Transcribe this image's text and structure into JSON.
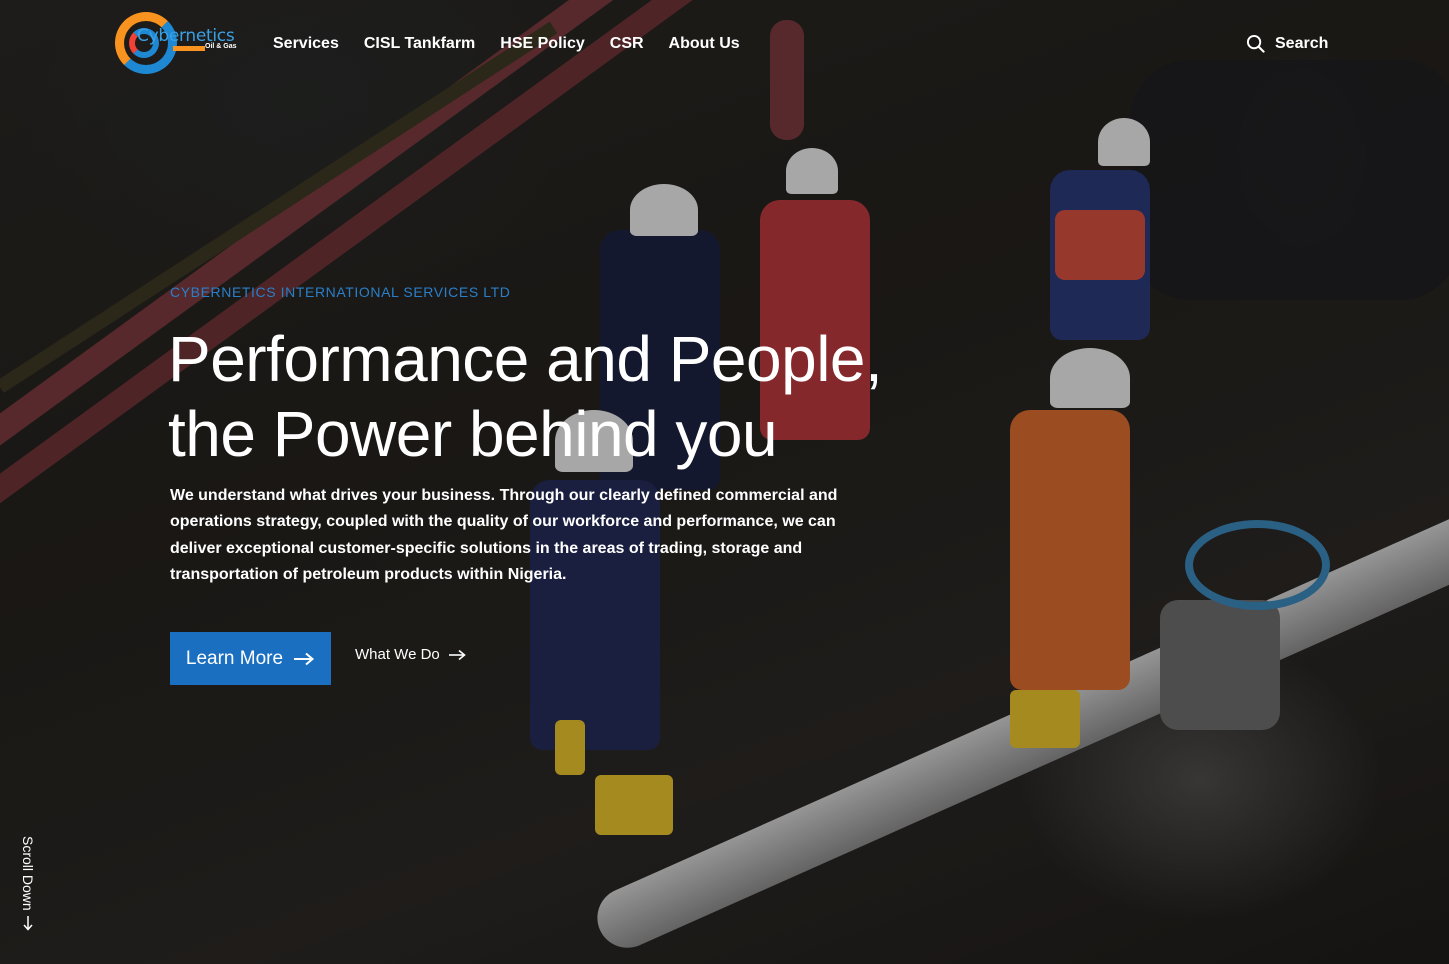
{
  "brand": {
    "logo_name": "Cybernetics",
    "logo_sub": "Oil & Gas",
    "accent_color": "#1a6fc0",
    "eyebrow_color": "#2a7fc9",
    "logo_orange": "#f7931e"
  },
  "nav": {
    "items": [
      {
        "label": "Services"
      },
      {
        "label": "CISL Tankfarm"
      },
      {
        "label": "HSE Policy"
      },
      {
        "label": "CSR"
      },
      {
        "label": "About Us"
      }
    ],
    "search_label": "Search",
    "search_icon": "search-icon"
  },
  "hero": {
    "eyebrow": "CYBERNETICS INTERNATIONAL SERVICES LTD",
    "headline_line1": "Performance and People,",
    "headline_line2": "the Power behind you",
    "body": "We understand what drives your business. Through our clearly defined commercial and operations strategy, coupled with the quality of our workforce and performance, we can deliver exceptional customer-specific solutions in the areas of trading, storage and transportation of petroleum products within Nigeria.",
    "primary_button": "Learn More",
    "secondary_link": "What We Do",
    "arrow_icon": "arrow-right-icon"
  },
  "scroll": {
    "label": "Scroll Down",
    "icon": "arrow-down-icon"
  }
}
